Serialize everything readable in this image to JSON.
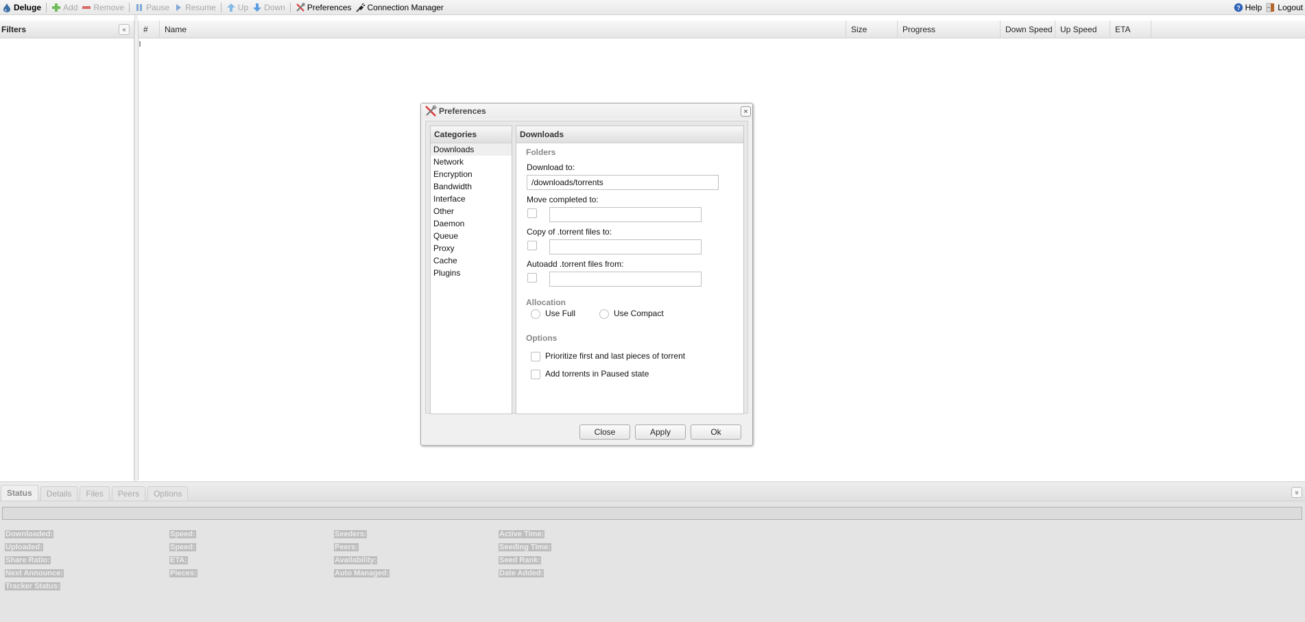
{
  "toolbar": {
    "brand": "Deluge",
    "add": "Add",
    "remove": "Remove",
    "pause": "Pause",
    "resume": "Resume",
    "up": "Up",
    "down": "Down",
    "preferences": "Preferences",
    "connection_manager": "Connection Manager",
    "help": "Help",
    "logout": "Logout"
  },
  "filters": {
    "title": "Filters",
    "collapse": "«"
  },
  "grid": {
    "columns": [
      "#",
      "Name",
      "Size",
      "Progress",
      "Down Speed",
      "Up Speed",
      "ETA"
    ]
  },
  "bottom": {
    "tabs": [
      "Status",
      "Details",
      "Files",
      "Peers",
      "Options"
    ],
    "active_tab": "Status",
    "collapse": "»",
    "status_columns": [
      [
        "Downloaded:",
        "Uploaded:",
        "Share Ratio:",
        "Next Announce:",
        "Tracker Status:"
      ],
      [
        "Speed:",
        "Speed:",
        "ETA:",
        "Pieces:"
      ],
      [
        "Seeders:",
        "Peers:",
        "Availability:",
        "Auto Managed:"
      ],
      [
        "Active Time:",
        "Seeding Time:",
        "Seed Rank:",
        "Date Added:"
      ]
    ]
  },
  "dialog": {
    "title": "Preferences",
    "close_glyph": "×",
    "categories_title": "Categories",
    "categories": [
      "Downloads",
      "Network",
      "Encryption",
      "Bandwidth",
      "Interface",
      "Other",
      "Daemon",
      "Queue",
      "Proxy",
      "Cache",
      "Plugins"
    ],
    "selected_category": "Downloads",
    "panel_title": "Downloads",
    "folders": {
      "legend": "Folders",
      "download_to_label": "Download to:",
      "download_to_value": "/downloads/torrents",
      "move_completed_label": "Move completed to:",
      "move_completed_value": "",
      "move_completed_checked": false,
      "copy_torrent_label": "Copy of .torrent files to:",
      "copy_torrent_value": "",
      "copy_torrent_checked": false,
      "autoadd_label": "Autoadd .torrent files from:",
      "autoadd_value": "",
      "autoadd_checked": false
    },
    "allocation": {
      "legend": "Allocation",
      "use_full": "Use Full",
      "use_compact": "Use Compact",
      "selected": null
    },
    "options": {
      "legend": "Options",
      "prioritize": "Prioritize first and last pieces of torrent",
      "prioritize_checked": false,
      "add_paused": "Add torrents in Paused state",
      "add_paused_checked": false
    },
    "buttons": {
      "close": "Close",
      "apply": "Apply",
      "ok": "Ok"
    }
  }
}
